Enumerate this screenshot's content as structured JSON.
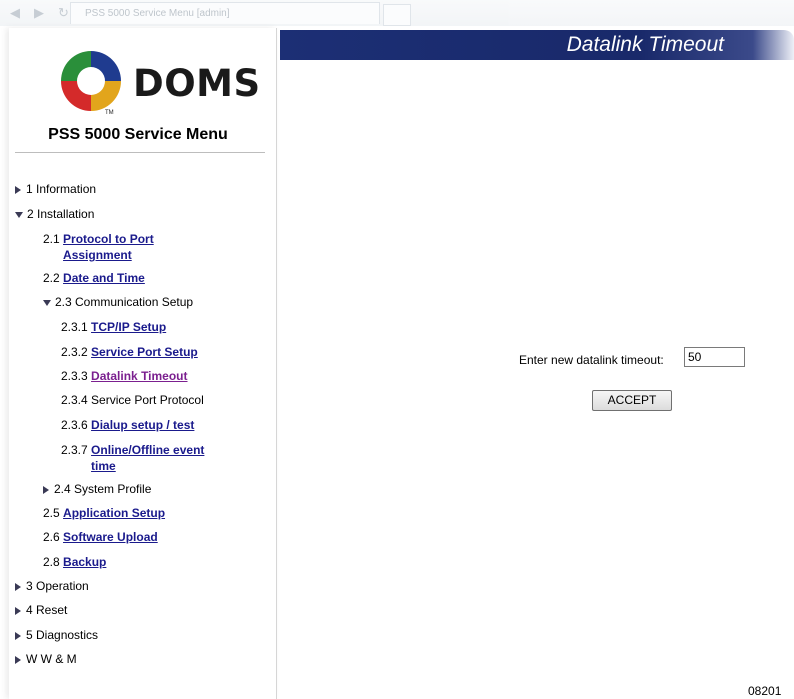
{
  "browser": {
    "tab_title": "PSS 5000 Service Menu [admin]",
    "nav_icons": [
      "back-icon",
      "forward-icon",
      "refresh-icon"
    ]
  },
  "brand": {
    "logo_text": "DOMS",
    "trademark": "TM",
    "menu_title": "PSS 5000 Service Menu",
    "logo_colors": [
      "#2a8f3a",
      "#1f3b8f",
      "#e2a51c",
      "#d42a2a"
    ]
  },
  "menu": {
    "info": "1 Information",
    "installation": "2 Installation",
    "i21_num": "2.1",
    "i21_link": "Protocol to Port Assignment",
    "i22_num": "2.2",
    "i22_link": "Date and Time",
    "i23": "2.3 Communication Setup",
    "i231_num": "2.3.1",
    "i231_link": "TCP/IP Setup",
    "i232_num": "2.3.2",
    "i232_link": "Service Port Setup",
    "i233_num": "2.3.3",
    "i233_link": "Datalink Timeout",
    "i234": "2.3.4 Service Port Protocol",
    "i236_num": "2.3.6",
    "i236_link": "Dialup setup / test",
    "i237_num": "2.3.7",
    "i237_link": "Online/Offline event time",
    "i24": "2.4 System Profile",
    "i25_num": "2.5",
    "i25_link": "Application Setup",
    "i26_num": "2.6",
    "i26_link": "Software Upload",
    "i28_num": "2.8",
    "i28_link": "Backup",
    "operation": "3 Operation",
    "reset": "4 Reset",
    "diagnostics": "5 Diagnostics",
    "wwm": "W W & M"
  },
  "page": {
    "title": "Datalink Timeout",
    "field_label": "Enter new datalink timeout:",
    "field_value": "50",
    "accept_label": "ACCEPT",
    "footer_code": "08201"
  },
  "colors": {
    "header_bg": "#1c2f75",
    "link": "#1a1a8c",
    "active_link": "#7b1f8f"
  }
}
